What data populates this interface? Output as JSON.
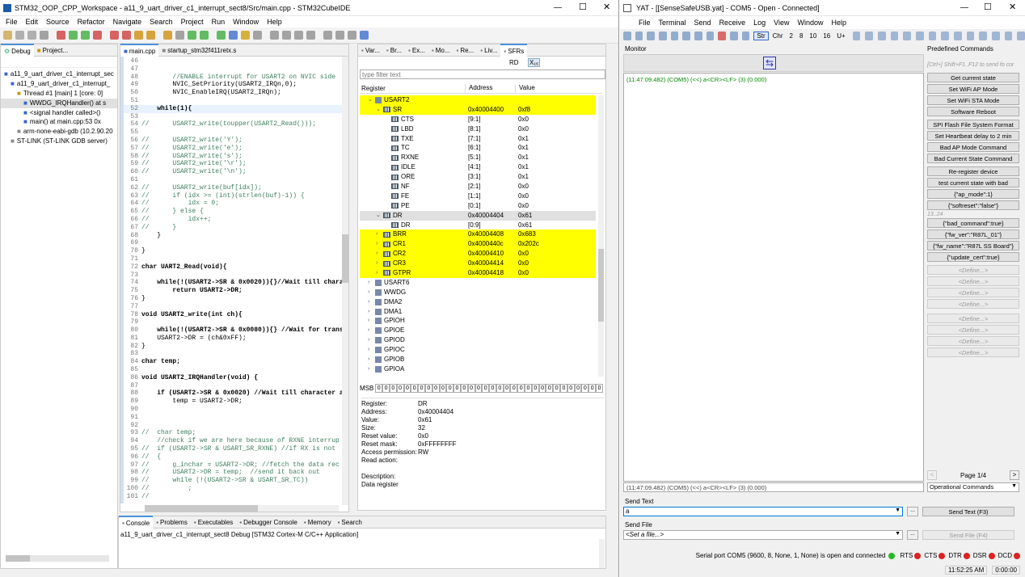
{
  "ide": {
    "title": "STM32_OOP_CPP_Workspace - a11_9_uart_driver_c1_interrupt_sect8/Src/main.cpp - STM32CubeIDE",
    "menu": [
      "File",
      "Edit",
      "Source",
      "Refactor",
      "Navigate",
      "Search",
      "Project",
      "Run",
      "Window",
      "Help"
    ],
    "left_tabs": [
      "Debug",
      "Project..."
    ],
    "debug_tree": [
      "a11_9_uart_driver_c1_interrupt_sec",
      "a11_9_uart_driver_c1_interrupt_",
      "Thread #1 [main] 1 [core: 0]",
      "WWDG_IRQHandler() at s",
      "<signal handler called>()",
      "main() at main.cpp:53 0x",
      "arm-none-eabi-gdb (10.2.90.20",
      "ST-LINK (ST-LINK GDB server)"
    ],
    "editor_tabs": [
      "main.cpp",
      "startup_stm32f411retx.s"
    ],
    "code": [
      {
        "n": "46",
        "t": ""
      },
      {
        "n": "47",
        "t": ""
      },
      {
        "n": "48",
        "t": "        //ENABLE interrupt for USART2 on NVIC side"
      },
      {
        "n": "49",
        "t": "        NVIC_SetPriority(USART2_IRQn,0);"
      },
      {
        "n": "50",
        "t": "        NVIC_EnableIRQ(USART2_IRQn);"
      },
      {
        "n": "51",
        "t": ""
      },
      {
        "n": "52",
        "t": "    while(1){"
      },
      {
        "n": "53",
        "t": ""
      },
      {
        "n": "54",
        "t": "//      USART2_write(toupper(USART2_Read()));"
      },
      {
        "n": "55",
        "t": ""
      },
      {
        "n": "56",
        "t": "//      USART2_write('Y');"
      },
      {
        "n": "57",
        "t": "//      USART2_write('e');"
      },
      {
        "n": "58",
        "t": "//      USART2_write('s');"
      },
      {
        "n": "59",
        "t": "//      USART2_write('\\r');"
      },
      {
        "n": "60",
        "t": "//      USART2_write('\\n');"
      },
      {
        "n": "61",
        "t": ""
      },
      {
        "n": "62",
        "t": "//      USART2_write(buf[idx]);"
      },
      {
        "n": "63",
        "t": "//      if (idx >= (int)(strlen(buf)-1)) {"
      },
      {
        "n": "64",
        "t": "//          idx = 0;"
      },
      {
        "n": "65",
        "t": "//      } else {"
      },
      {
        "n": "66",
        "t": "//          idx++;"
      },
      {
        "n": "67",
        "t": "//      }"
      },
      {
        "n": "68",
        "t": "    }"
      },
      {
        "n": "69",
        "t": ""
      },
      {
        "n": "70",
        "t": "}"
      },
      {
        "n": "71",
        "t": ""
      },
      {
        "n": "72",
        "t": "char UART2_Read(void){"
      },
      {
        "n": "73",
        "t": ""
      },
      {
        "n": "74",
        "t": "    while(!(USART2->SR & 0x0020)){}//Wait till chara"
      },
      {
        "n": "75",
        "t": "        return USART2->DR;"
      },
      {
        "n": "76",
        "t": "}"
      },
      {
        "n": "77",
        "t": ""
      },
      {
        "n": "78",
        "t": "void USART2_write(int ch){"
      },
      {
        "n": "79",
        "t": ""
      },
      {
        "n": "80",
        "t": "    while(!(USART2->SR & 0x0080)){} //Wait for trans"
      },
      {
        "n": "81",
        "t": "    USART2->DR = (ch&0xFF);"
      },
      {
        "n": "82",
        "t": "}"
      },
      {
        "n": "83",
        "t": ""
      },
      {
        "n": "84",
        "t": "char temp;"
      },
      {
        "n": "85",
        "t": ""
      },
      {
        "n": "86",
        "t": "void USART2_IRQHandler(void) {"
      },
      {
        "n": "87",
        "t": ""
      },
      {
        "n": "88",
        "t": "    if (USART2->SR & 0x0020) //Wait till character a"
      },
      {
        "n": "89",
        "t": "        temp = USART2->DR;"
      },
      {
        "n": "90",
        "t": ""
      },
      {
        "n": "91",
        "t": ""
      },
      {
        "n": "92",
        "t": ""
      },
      {
        "n": "93",
        "t": "//  char temp;"
      },
      {
        "n": "94",
        "t": "    //check if we are here because of RXNE interrup"
      },
      {
        "n": "95",
        "t": "//  if (USART2->SR & USART_SR_RXNE) //if RX is not"
      },
      {
        "n": "96",
        "t": "//  {"
      },
      {
        "n": "97",
        "t": "//      g_inchar = USART2->DR; //fetch the data rec"
      },
      {
        "n": "98",
        "t": "//      USART2->DR = temp;  //send it back out"
      },
      {
        "n": "99",
        "t": "//      while (!(USART2->SR & USART_SR_TC))"
      },
      {
        "n": "100",
        "t": "//          ;"
      },
      {
        "n": "101",
        "t": "//"
      }
    ],
    "sfr_tabs": [
      "Var...",
      "Br...",
      "Ex...",
      "Mo...",
      "Re...",
      "Liv...",
      "SFRs"
    ],
    "rd_label": "RD",
    "filter_placeholder": "type filter text",
    "sfr_headers": [
      "Register",
      "Address",
      "Value"
    ],
    "sfr_rows": [
      {
        "name": "USART2",
        "addr": "",
        "val": "",
        "lvl": 1,
        "hl": true,
        "exp": "v"
      },
      {
        "name": "SR",
        "addr": "0x40004400",
        "val": "0xf8",
        "lvl": 2,
        "hl": true,
        "exp": "v",
        "reg": true
      },
      {
        "name": "CTS",
        "addr": "[9:1]",
        "val": "0x0",
        "lvl": 3,
        "reg": true
      },
      {
        "name": "LBD",
        "addr": "[8:1]",
        "val": "0x0",
        "lvl": 3,
        "reg": true
      },
      {
        "name": "TXE",
        "addr": "[7:1]",
        "val": "0x1",
        "lvl": 3,
        "reg": true
      },
      {
        "name": "TC",
        "addr": "[6:1]",
        "val": "0x1",
        "lvl": 3,
        "reg": true
      },
      {
        "name": "RXNE",
        "addr": "[5:1]",
        "val": "0x1",
        "lvl": 3,
        "reg": true
      },
      {
        "name": "IDLE",
        "addr": "[4:1]",
        "val": "0x1",
        "lvl": 3,
        "reg": true
      },
      {
        "name": "ORE",
        "addr": "[3:1]",
        "val": "0x1",
        "lvl": 3,
        "reg": true
      },
      {
        "name": "NF",
        "addr": "[2:1]",
        "val": "0x0",
        "lvl": 3,
        "reg": true
      },
      {
        "name": "FE",
        "addr": "[1:1]",
        "val": "0x0",
        "lvl": 3,
        "reg": true
      },
      {
        "name": "PE",
        "addr": "[0:1]",
        "val": "0x0",
        "lvl": 3,
        "reg": true
      },
      {
        "name": "DR",
        "addr": "0x40004404",
        "val": "0x61",
        "lvl": 2,
        "sel": true,
        "exp": "v",
        "reg": true
      },
      {
        "name": "DR",
        "addr": "[0:9]",
        "val": "0x61",
        "lvl": 3,
        "reg": true
      },
      {
        "name": "BRR",
        "addr": "0x40004408",
        "val": "0x683",
        "lvl": 2,
        "hl": true,
        "exp": ">",
        "reg": true
      },
      {
        "name": "CR1",
        "addr": "0x4000440c",
        "val": "0x202c",
        "lvl": 2,
        "hl": true,
        "exp": ">",
        "reg": true
      },
      {
        "name": "CR2",
        "addr": "0x40004410",
        "val": "0x0",
        "lvl": 2,
        "hl": true,
        "exp": ">",
        "reg": true
      },
      {
        "name": "CR3",
        "addr": "0x40004414",
        "val": "0x0",
        "lvl": 2,
        "hl": true,
        "exp": ">",
        "reg": true
      },
      {
        "name": "GTPR",
        "addr": "0x40004418",
        "val": "0x0",
        "lvl": 2,
        "hl": true,
        "exp": ">",
        "reg": true
      },
      {
        "name": "USART6",
        "addr": "",
        "val": "",
        "lvl": 1,
        "exp": ">"
      },
      {
        "name": "WWDG",
        "addr": "",
        "val": "",
        "lvl": 1,
        "exp": ">"
      },
      {
        "name": "DMA2",
        "addr": "",
        "val": "",
        "lvl": 1,
        "exp": ">"
      },
      {
        "name": "DMA1",
        "addr": "",
        "val": "",
        "lvl": 1,
        "exp": ">"
      },
      {
        "name": "GPIOH",
        "addr": "",
        "val": "",
        "lvl": 1,
        "exp": ">"
      },
      {
        "name": "GPIOE",
        "addr": "",
        "val": "",
        "lvl": 1,
        "exp": ">"
      },
      {
        "name": "GPIOD",
        "addr": "",
        "val": "",
        "lvl": 1,
        "exp": ">"
      },
      {
        "name": "GPIOC",
        "addr": "",
        "val": "",
        "lvl": 1,
        "exp": ">"
      },
      {
        "name": "GPIOB",
        "addr": "",
        "val": "",
        "lvl": 1,
        "exp": ">"
      },
      {
        "name": "GPIOA",
        "addr": "",
        "val": "",
        "lvl": 1,
        "exp": ">"
      }
    ],
    "msb_label": "MSB",
    "bits": [
      "0",
      "0",
      "0",
      "0",
      "0",
      "0",
      "0",
      "0",
      "0",
      "0",
      "0",
      "0",
      "0",
      "0",
      "0",
      "0",
      "0",
      "0",
      "0",
      "0",
      "0",
      "0",
      "0",
      "0",
      "0",
      "0",
      "0",
      "0",
      "0",
      "0",
      "0",
      "0"
    ],
    "details": [
      {
        "k": "Register:",
        "v": "DR"
      },
      {
        "k": "Address:",
        "v": "0x40004404"
      },
      {
        "k": "Value:",
        "v": "0x61"
      },
      {
        "k": "Size:",
        "v": "32"
      },
      {
        "k": "Reset value:",
        "v": "0x0"
      },
      {
        "k": "Reset mask:",
        "v": "0xFFFFFFFF"
      },
      {
        "k": "Access permission:",
        "v": "RW"
      },
      {
        "k": "Read action:",
        "v": ""
      },
      {
        "k": "",
        "v": ""
      },
      {
        "k": "Description:",
        "v": ""
      },
      {
        "k": "Data register",
        "v": ""
      }
    ],
    "bottom_tabs": [
      "Console",
      "Problems",
      "Executables",
      "Debugger Console",
      "Memory",
      "Search"
    ],
    "console_text": "a11_9_uart_driver_c1_interrupt_sect8 Debug [STM32 Cortex-M C/C++ Application]"
  },
  "yat": {
    "title": "YAT - [[SenseSafeUSB.yat] - COM5 - Open - Connected]",
    "menu": [
      "File",
      "Terminal",
      "Send",
      "Receive",
      "Log",
      "View",
      "Window",
      "Help"
    ],
    "tool_text": [
      "Str",
      "Chr",
      "2",
      "8",
      "10",
      "16",
      "U+"
    ],
    "monitor_label": "Monitor",
    "monitor_line": "(11:47:09.482) (COM5) (<<) a<CR><LF> (3) (0.000)",
    "status_line": "(11:47:09.482) (COM5) (<<) a<CR><LF> (3) (0.000)",
    "send_text_label": "Send Text",
    "send_text_value": "a",
    "send_text_button": "Send Text (F3)",
    "send_file_label": "Send File",
    "send_file_value": "<Set a file...>",
    "send_file_button": "Send File (F4)",
    "predef_title": "Predefined Commands",
    "predef_hint": "[Ctrl+] Shift+F1..F12 to send fo cor",
    "predef_buttons_a": [
      "Get current state",
      "Set WiFi AP Mode",
      "Set WiFi STA Mode",
      "Software Reboot"
    ],
    "predef_buttons_b": [
      "SPI Flash File System Format",
      "Set Heartbeat delay to 2 min",
      "Bad AP Mode Command",
      "Bad Current State Command"
    ],
    "predef_buttons_c": [
      "Re-register device",
      "test current state with bad",
      "{\"ap_mode\":1}",
      "{\"softreset\":\"false\"}"
    ],
    "predef_sep": "13..24",
    "predef_buttons_d": [
      "{\"bad_command\":true}",
      "{\"fw_ver\":\"R87L_01\"}",
      "{\"fw_name\":\"R87L SS Board\"}",
      "{\"update_cert\":true}"
    ],
    "define_label": "<Define...>",
    "page_label": "Page 1/4",
    "operational": "Operational Commands",
    "port_status": "Serial port COM5 (9600, 8, None, 1, None) is open and connected",
    "signals": [
      "RTS",
      "CTS",
      "DTR",
      "DSR",
      "DCD"
    ],
    "time": "11:52:25 AM",
    "elapsed": "0:00:00"
  }
}
